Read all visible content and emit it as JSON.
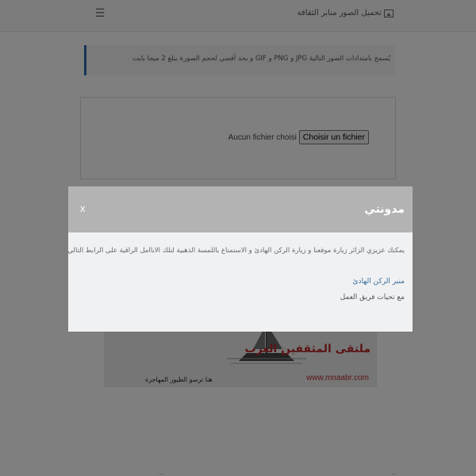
{
  "navbar": {
    "brand": "تحميل الصور منابر الثقافة",
    "brand_icon": "image-icon",
    "menu_icon": "☰"
  },
  "info": {
    "text": "يُسمح بامتدادات الصور التالية JPG و PNG و GIF و بحد أقصى لحجم الصورة يبلغ 2 ميجا بايت"
  },
  "upload": {
    "status": "Aucun fichier choisi",
    "button": "Choisir un fichier"
  },
  "banner": {
    "title": "ملتقى المثقفين العرب",
    "url": "www.mnaabr.com",
    "slogan": "هنا ترسو الطيور المهاجرة"
  },
  "footer": {
    "left": "...",
    "right": "..."
  },
  "modal": {
    "title": "مدونتي",
    "close": "x",
    "paragraph": "يمكنك عزيزي الزائر زيارة موقعنا و زيارة الركن الهادئ و الاستمتاع باللمسة الذهبية لتلك الاناامل الراقية على الرابط التالي :",
    "link": "منبر الركن الهادئ",
    "signature": "مع تحيات فريق العمل"
  },
  "colors": {
    "overlay": "rgba(0,0,0,0.5)",
    "modal_header": "#b3b3b3",
    "accent_border": "#2a6aa8",
    "link": "#3a6f99",
    "banner_red": "#b72a2a"
  }
}
